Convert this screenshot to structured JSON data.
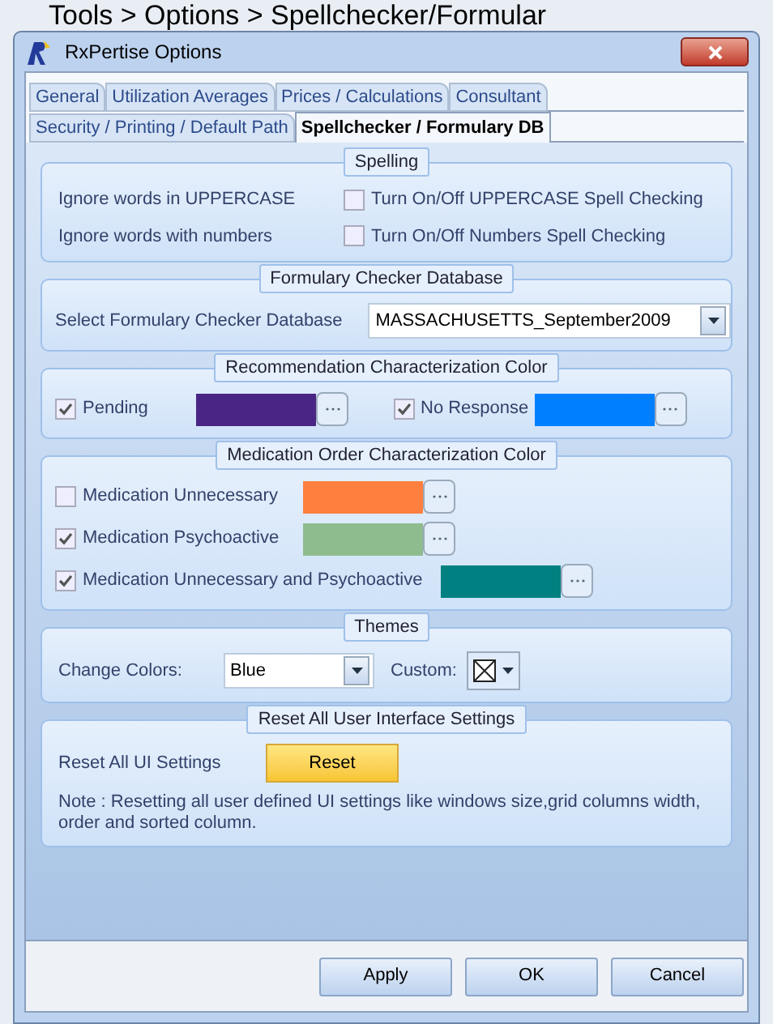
{
  "caption": "Tools > Options > Spellchecker/Formular",
  "window": {
    "title": "RxPertise  Options"
  },
  "tab_rows": [
    [
      {
        "label": "General",
        "selected": false
      },
      {
        "label": "Utilization Averages",
        "selected": false
      },
      {
        "label": "Prices / Calculations",
        "selected": false
      },
      {
        "label": "Consultant",
        "selected": false
      }
    ],
    [
      {
        "label": "Security / Printing / Default Path",
        "selected": false
      },
      {
        "label": "Spellchecker / Formulary DB",
        "selected": true
      }
    ]
  ],
  "sections": [
    {
      "kind": "spelling",
      "title": "Spelling",
      "rows": [
        {
          "label": "Ignore words in UPPERCASE",
          "checkbox_label": "Turn On/Off  UPPERCASE Spell Checking",
          "checked": false
        },
        {
          "label": "Ignore words with numbers",
          "checkbox_label": "Turn On/Off  Numbers Spell Checking",
          "checked": false
        }
      ]
    },
    {
      "kind": "select",
      "title": "Formulary Checker Database",
      "label": "Select Formulary Checker Database",
      "value": "MASSACHUSETTS_September2009"
    },
    {
      "kind": "colors_inline",
      "title": "Recommendation Characterization Color",
      "items": [
        {
          "label": "Pending",
          "checked": true,
          "color": "#4b2585"
        },
        {
          "label": "No Response",
          "checked": true,
          "color": "#0080ff"
        }
      ]
    },
    {
      "kind": "colors_list",
      "title": "Medication Order Characterization Color",
      "items": [
        {
          "label": "Medication Unnecessary",
          "checked": false,
          "color": "#ff7f3f"
        },
        {
          "label": "Medication Psychoactive",
          "checked": true,
          "color": "#8fbc8f"
        },
        {
          "label": "Medication Unnecessary and Psychoactive",
          "checked": true,
          "color": "#008080"
        }
      ]
    },
    {
      "kind": "themes",
      "title": "Themes",
      "label": "Change Colors:",
      "value": "Blue",
      "custom_label": "Custom:"
    },
    {
      "kind": "reset",
      "title": "Reset All User Interface Settings",
      "label": "Reset All UI Settings",
      "button": "Reset",
      "note": "Note :  Resetting all user defined UI settings like windows size,grid columns width, order and sorted column."
    }
  ],
  "buttons": [
    "Apply",
    "OK",
    "Cancel"
  ]
}
